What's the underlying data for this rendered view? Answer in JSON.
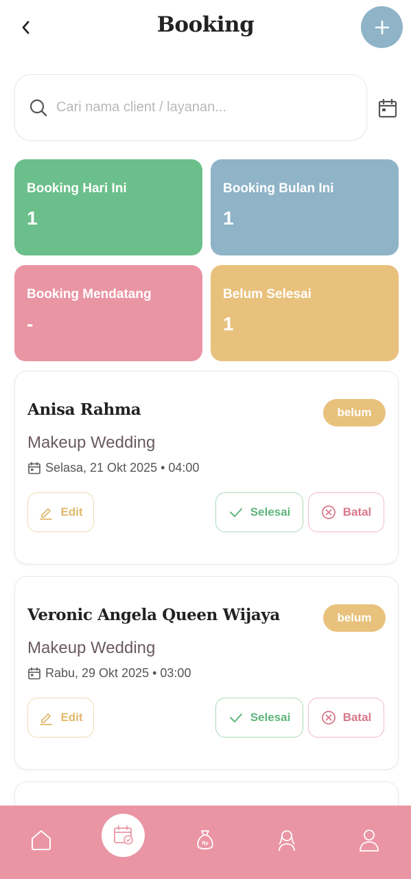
{
  "header": {
    "title": "Booking",
    "back_icon": "chevron-left-icon",
    "add_icon": "plus-icon"
  },
  "search": {
    "placeholder": "Cari nama client / layanan...",
    "value": ""
  },
  "stats": [
    {
      "label": "Booking Hari Ini",
      "value": "1",
      "color": "#6bbf8a"
    },
    {
      "label": "Booking Bulan Ini",
      "value": "1",
      "color": "#8fb3c7"
    },
    {
      "label": "Booking Mendatang",
      "value": "-",
      "color": "#ea95a4"
    },
    {
      "label": "Belum Selesai",
      "value": "1",
      "color": "#e8c17c"
    }
  ],
  "bookings": [
    {
      "client": "Anisa Rahma",
      "status": "belum",
      "service": "Makeup Wedding",
      "datetime": "Selasa, 21 Okt 2025 • 04:00"
    },
    {
      "client": "Veronic Angela Queen Wijaya",
      "status": "belum",
      "service": "Makeup Wedding",
      "datetime": "Rabu, 29 Okt 2025 • 03:00"
    }
  ],
  "actions": {
    "edit": "Edit",
    "done": "Selesai",
    "cancel": "Batal"
  },
  "nav": [
    {
      "icon": "home-icon",
      "active": false
    },
    {
      "icon": "calendar-check-icon",
      "active": true
    },
    {
      "icon": "money-bag-icon",
      "active": false
    },
    {
      "icon": "client-woman-icon",
      "active": false
    },
    {
      "icon": "profile-icon",
      "active": false
    }
  ],
  "colors": {
    "accent_pink": "#ea95a4",
    "accent_blue": "#8fb3c7",
    "green": "#6bbf8a",
    "yellow": "#e8c17c"
  }
}
